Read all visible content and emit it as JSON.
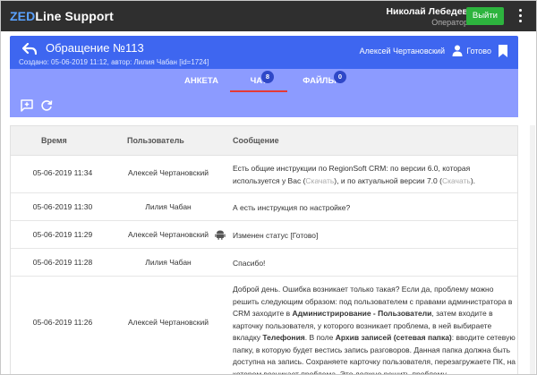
{
  "app": {
    "logo_prefix": "ZED",
    "logo_suffix": "Line Support",
    "user_name": "Николай Лебедев",
    "user_role": "Оператор",
    "logout_label": "Выйти",
    "menu_icon": "kebab-menu-icon"
  },
  "ticket": {
    "title": "Обращение №113",
    "subtitle": "Создано: 05-06-2019 11:12, автор: Лилия Чабан [id=1724]",
    "assignee": "Алексей Чертановский",
    "status_label": "Готово",
    "icons": [
      "back-arrow-icon",
      "person-icon",
      "bookmark-icon"
    ]
  },
  "tabs": [
    {
      "label": "АНКЕТА"
    },
    {
      "label": "ЧАТ",
      "badge": "8",
      "active": true
    },
    {
      "label": "ФАЙЛЫ",
      "badge": "0"
    }
  ],
  "toolbar": {
    "icons": [
      "add-comment-icon",
      "refresh-icon"
    ]
  },
  "table": {
    "headers": {
      "time": "Время",
      "user": "Пользователь",
      "message": "Сообщение"
    },
    "rows": [
      {
        "time": "05-06-2019 11:34",
        "user": "Алексей Чертановский",
        "msg_parts": [
          {
            "t": "Есть общие инструкции по RegionSoft CRM: по версии 6.0, которая используется у Вас (",
            "s": ""
          },
          {
            "t": "Скачать",
            "s": "lnk"
          },
          {
            "t": "), и по актуальной версии 7.0 (",
            "s": ""
          },
          {
            "t": "Скачать",
            "s": "lnk"
          },
          {
            "t": ").",
            "s": ""
          }
        ]
      },
      {
        "time": "05-06-2019 11:30",
        "user": "Лилия Чабан",
        "msg_parts": [
          {
            "t": "А есть инструкция по настройке?",
            "s": ""
          }
        ]
      },
      {
        "time": "05-06-2019 11:29",
        "user": "Алексей Чертановский",
        "icon": "android-icon",
        "msg_parts": [
          {
            "t": "Изменен статус [Готово]",
            "s": ""
          }
        ]
      },
      {
        "time": "05-06-2019 11:28",
        "user": "Лилия Чабан",
        "msg_parts": [
          {
            "t": "Спасибо!",
            "s": ""
          }
        ]
      },
      {
        "time": "05-06-2019 11:26",
        "user": "Алексей Чертановский",
        "msg_parts": [
          {
            "t": "Доброй день. Ошибка возникает только такая? Если да, проблему можно решить следующим образом: под пользователем с правами администратора в CRM заходите в ",
            "s": ""
          },
          {
            "t": "Администрирование - Пользователи",
            "s": "b"
          },
          {
            "t": ", затем входите в карточку пользователя, у которого возникает проблема, в ней выбираете вкладку ",
            "s": ""
          },
          {
            "t": "Телефония",
            "s": "b"
          },
          {
            "t": ". В поле ",
            "s": ""
          },
          {
            "t": "Архив записей (сетевая папка)",
            "s": "b"
          },
          {
            "t": ": вводите сетевую папку, в которую будет вестись запись разговоров. Данная папка должна быть доступна на запись. Сохраняете карточку пользователя, перезагружаете ПК, на котором возникает проблема. Это должно решить проблему.",
            "s": ""
          }
        ]
      }
    ]
  },
  "colors": {
    "topbar": "#2f2f2f",
    "ticket_header": "#3e66f0",
    "tabs_bg": "#8c9bff",
    "logout_button": "#2db43e",
    "active_tab_underline": "#e53935",
    "badge": "#2f48c8"
  }
}
